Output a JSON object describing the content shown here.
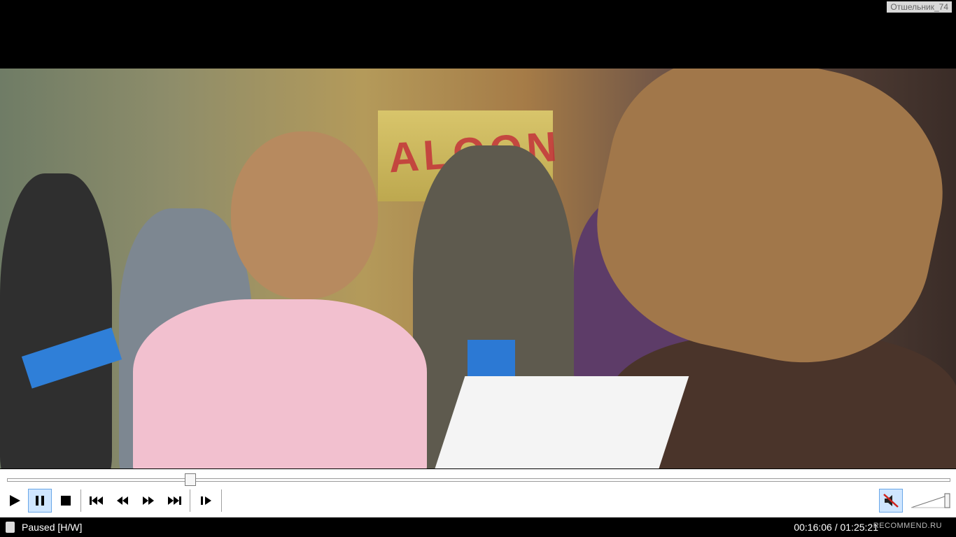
{
  "overlay": {
    "watermark": "Отшельник_74"
  },
  "video": {
    "sign_text": "ALOON"
  },
  "player": {
    "progress_fraction": 0.194,
    "volume_fraction": 1.0,
    "muted": true,
    "buttons": [
      {
        "name": "play",
        "icon": "play-icon"
      },
      {
        "name": "pause",
        "icon": "pause-icon",
        "active": true
      },
      {
        "name": "stop",
        "icon": "stop-icon"
      },
      {
        "name": "previous",
        "icon": "skip-back-icon"
      },
      {
        "name": "rewind",
        "icon": "rewind-icon"
      },
      {
        "name": "forward",
        "icon": "fast-forward-icon"
      },
      {
        "name": "next",
        "icon": "skip-forward-icon"
      },
      {
        "name": "frame-step",
        "icon": "frame-step-icon"
      }
    ]
  },
  "status": {
    "state": "Paused [H/W]",
    "time": "00:16:06 / 01:25:21",
    "badge": "RECOMMEND.RU"
  }
}
